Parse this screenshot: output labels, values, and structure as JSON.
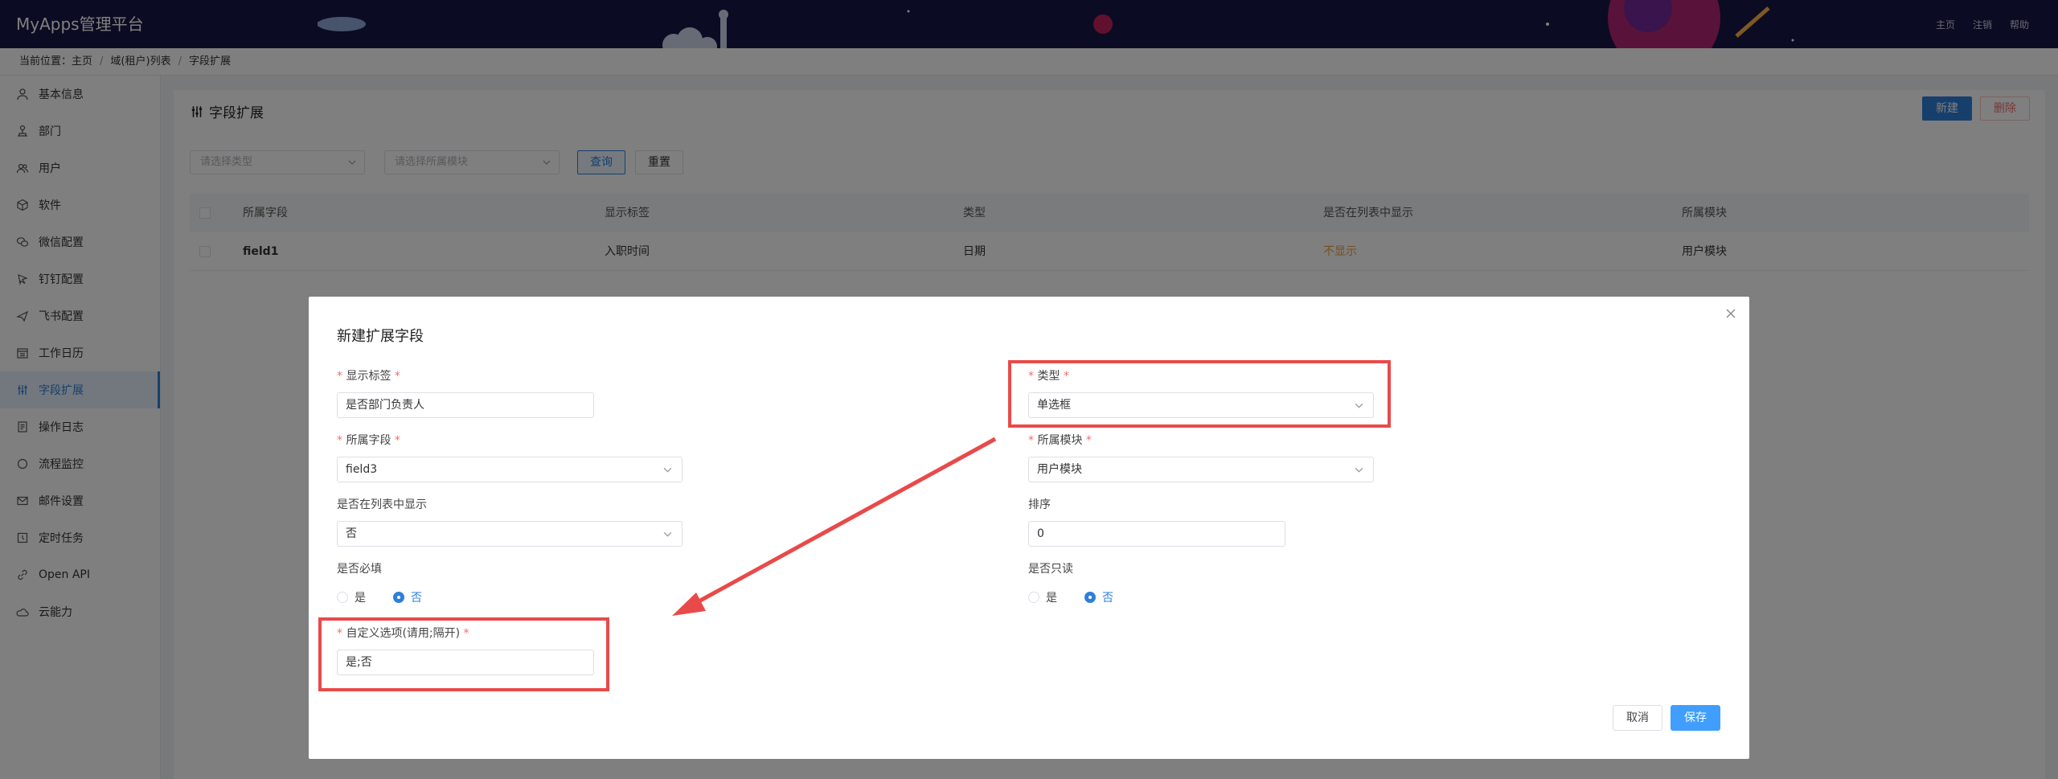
{
  "app": {
    "title": "MyApps管理平台",
    "nav": [
      "主页",
      "注销",
      "帮助"
    ]
  },
  "breadcrumb": {
    "prefix": "当前位置：",
    "items": [
      "主页",
      "域(租户)列表",
      "字段扩展"
    ]
  },
  "sidebar": {
    "items": [
      {
        "label": "基本信息",
        "icon": "user-icon"
      },
      {
        "label": "部门",
        "icon": "org-icon"
      },
      {
        "label": "用户",
        "icon": "users-icon"
      },
      {
        "label": "软件",
        "icon": "cube-icon"
      },
      {
        "label": "微信配置",
        "icon": "wechat-icon"
      },
      {
        "label": "钉钉配置",
        "icon": "dingtalk-icon"
      },
      {
        "label": "飞书配置",
        "icon": "feishu-icon"
      },
      {
        "label": "工作日历",
        "icon": "calendar-icon"
      },
      {
        "label": "字段扩展",
        "icon": "sliders-icon",
        "active": true
      },
      {
        "label": "操作日志",
        "icon": "log-icon"
      },
      {
        "label": "流程监控",
        "icon": "monitor-icon"
      },
      {
        "label": "邮件设置",
        "icon": "mail-icon"
      },
      {
        "label": "定时任务",
        "icon": "timer-icon"
      },
      {
        "label": "Open API",
        "icon": "link-icon"
      },
      {
        "label": "云能力",
        "icon": "cloud-icon"
      }
    ]
  },
  "page": {
    "title": "字段扩展",
    "new_label": "新建",
    "delete_label": "删除",
    "filters": {
      "type_placeholder": "请选择类型",
      "module_placeholder": "请选择所属模块",
      "query_label": "查询",
      "reset_label": "重置"
    },
    "table": {
      "columns": [
        "所属字段",
        "显示标签",
        "类型",
        "是否在列表中显示",
        "所属模块"
      ],
      "rows": [
        {
          "field": "field1",
          "label": "入职时间",
          "type": "日期",
          "show_in_list": "不显示",
          "module": "用户模块"
        }
      ]
    }
  },
  "modal": {
    "title": "新建扩展字段",
    "fields": {
      "display_label": {
        "label": "显示标签",
        "value": "是否部门负责人"
      },
      "type": {
        "label": "类型",
        "value": "单选框"
      },
      "field": {
        "label": "所属字段",
        "value": "field3"
      },
      "module": {
        "label": "所属模块",
        "value": "用户模块"
      },
      "show_in_list": {
        "label": "是否在列表中显示",
        "value": "否"
      },
      "sort": {
        "label": "排序",
        "value": "0"
      },
      "required": {
        "label": "是否必填",
        "options": [
          "是",
          "否"
        ],
        "selected": "否"
      },
      "readonly": {
        "label": "是否只读",
        "options": [
          "是",
          "否"
        ],
        "selected": "否"
      },
      "custom_options": {
        "label": "自定义选项(请用;隔开)",
        "value": "是;否"
      }
    },
    "cancel_label": "取消",
    "save_label": "保存"
  },
  "annotations": {
    "highlight_color": "#e84a4a"
  },
  "colors": {
    "primary": "#2f7fd9",
    "header_bg": "#171646",
    "danger": "#f56c6c",
    "warning_text": "#e6a23c"
  }
}
